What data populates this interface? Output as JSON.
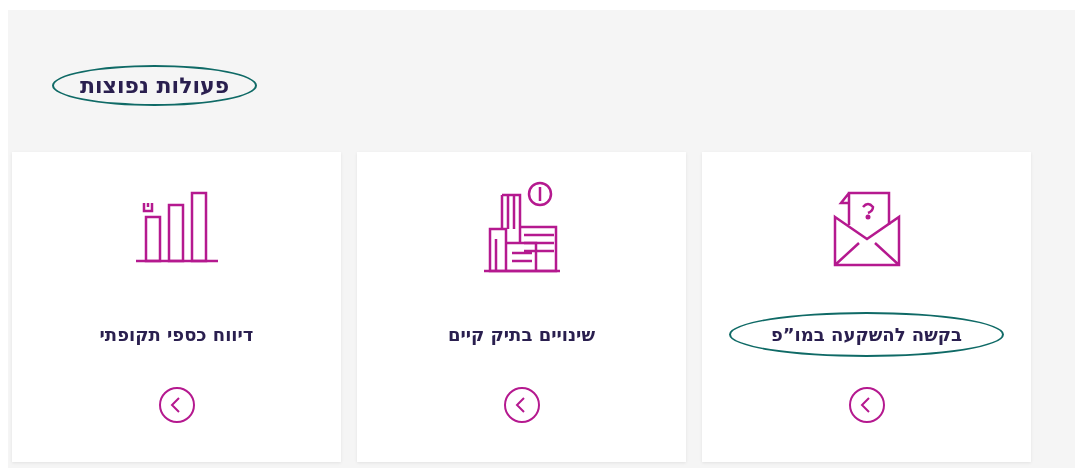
{
  "heading": {
    "text": "פעולות נפוצות",
    "highlighted": true
  },
  "cards": [
    {
      "kind": "envelope",
      "title": "בקשה להשקעה במו”פ",
      "highlighted": true
    },
    {
      "kind": "buildings",
      "title": "שינויים בתיק קיים",
      "highlighted": false
    },
    {
      "kind": "chart",
      "title": "דיווח כספי תקופתי",
      "highlighted": false
    }
  ]
}
